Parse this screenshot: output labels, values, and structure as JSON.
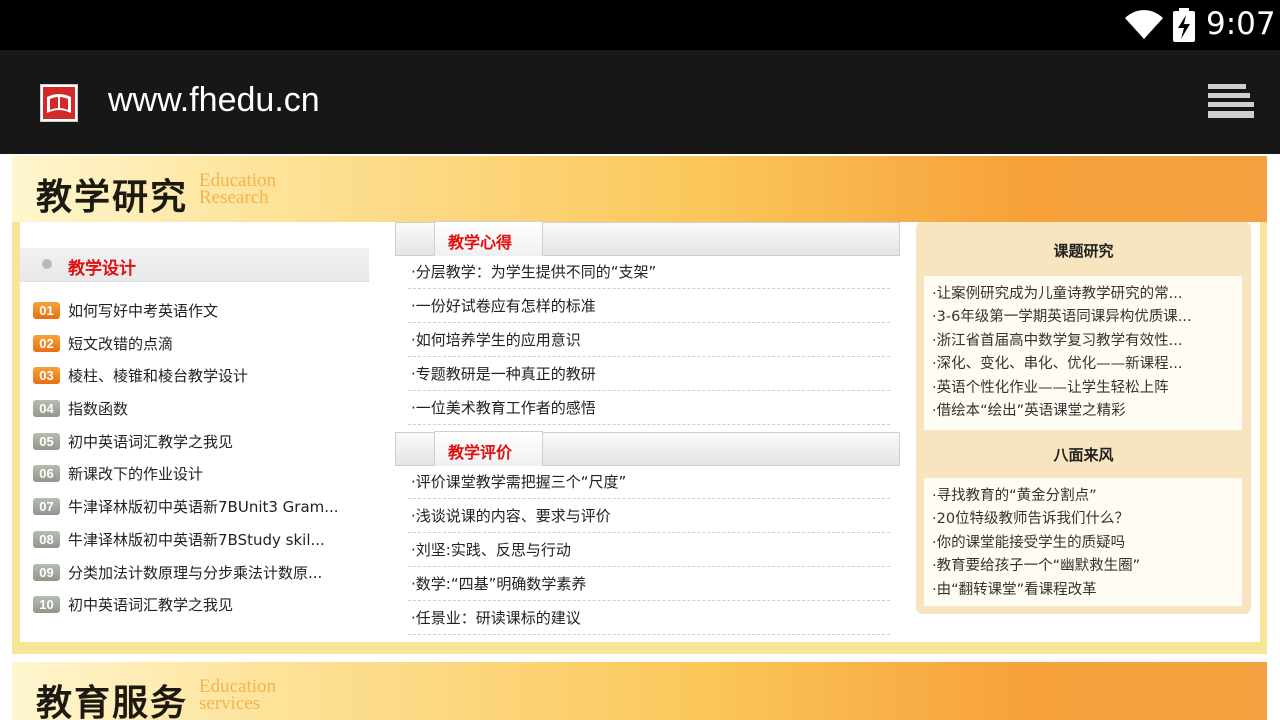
{
  "status_bar": {
    "time": "9:07",
    "wifi_icon": "wifi-icon",
    "battery_icon": "battery-charging-icon"
  },
  "browser": {
    "url": "www.fhedu.cn",
    "site_icon": "site-logo-icon",
    "menu_icon": "menu-icon"
  },
  "sections": {
    "research": {
      "title_cn": "教学研究",
      "title_en_line1": "Education",
      "title_en_line2": "Research"
    },
    "services": {
      "title_cn": "教育服务",
      "title_en_line1": "Education",
      "title_en_line2": "services"
    }
  },
  "teaching_design": {
    "title": "教学设计",
    "items": [
      {
        "num": "01",
        "text": "如何写好中考英语作文"
      },
      {
        "num": "02",
        "text": "短文改错的点滴"
      },
      {
        "num": "03",
        "text": "棱柱、棱锥和棱台教学设计"
      },
      {
        "num": "04",
        "text": "指数函数"
      },
      {
        "num": "05",
        "text": "初中英语词汇教学之我见"
      },
      {
        "num": "06",
        "text": "新课改下的作业设计"
      },
      {
        "num": "07",
        "text": "牛津译林版初中英语新7BUnit3 Gram..."
      },
      {
        "num": "08",
        "text": "牛津译林版初中英语新7BStudy skil..."
      },
      {
        "num": "09",
        "text": "分类加法计数原理与分步乘法计数原..."
      },
      {
        "num": "10",
        "text": "初中英语词汇教学之我见"
      }
    ]
  },
  "teaching_experience": {
    "title": "教学心得",
    "items": [
      "·分层教学：为学生提供不同的“支架”",
      "·一份好试卷应有怎样的标准",
      "·如何培养学生的应用意识",
      "·专题教研是一种真正的教研",
      "·一位美术教育工作者的感悟"
    ]
  },
  "teaching_evaluation": {
    "title": "教学评价",
    "items": [
      "·评价课堂教学需把握三个“尺度”",
      "·浅谈说课的内容、要求与评价",
      "·刘坚:实践、反思与行动",
      "·数学:“四基”明确数学素养",
      "·任景业：研读课标的建议"
    ]
  },
  "topic_research": {
    "title": "课题研究",
    "items": [
      "·让案例研究成为儿童诗教学研究的常...",
      "·3-6年级第一学期英语同课异构优质课...",
      "·浙江省首届高中数学复习教学有效性...",
      "·深化、变化、串化、优化——新课程...",
      "·英语个性化作业——让学生轻松上阵",
      "·借绘本“绘出”英语课堂之精彩"
    ]
  },
  "all_directions": {
    "title": "八面来风",
    "items": [
      "·寻找教育的“黄金分割点”",
      "·20位特级教师告诉我们什么？",
      "·你的课堂能接受学生的质疑吗",
      "·教育要给孩子一个“幽默救生圈”",
      "·由“翻转课堂”看课程改革"
    ]
  }
}
